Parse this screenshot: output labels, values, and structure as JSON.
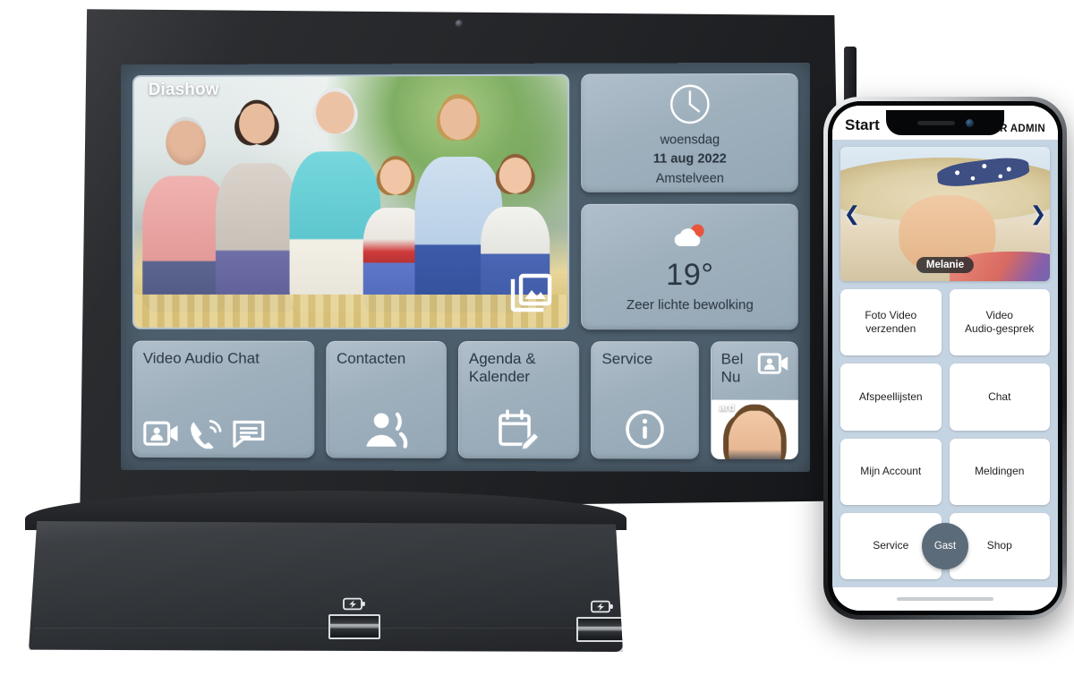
{
  "tablet": {
    "slideshow": {
      "label": "Diashow",
      "gallery_icon": "photo-library-icon"
    },
    "clock_widget": {
      "icon": "analog-clock-icon",
      "weekday": "woensdag",
      "date": "11 aug  2022",
      "location": "Amstelveen"
    },
    "weather_widget": {
      "icon": "sun-behind-cloud-icon",
      "temperature": "19°",
      "description": "Zeer lichte bewolking"
    },
    "actions": [
      {
        "id": "video-audio-chat",
        "label": "Video Audio Chat",
        "icons": [
          "video-call-icon",
          "phone-ring-icon",
          "chat-bubble-icon"
        ]
      },
      {
        "id": "contacten",
        "label": "Contacten",
        "icons": [
          "contacts-person-icon"
        ]
      },
      {
        "id": "agenda-kalender",
        "label": "Agenda &\nKalender",
        "label_line1": "Agenda &",
        "label_line2": "Kalender",
        "icons": [
          "calendar-edit-icon"
        ]
      },
      {
        "id": "service",
        "label": "Service",
        "icons": [
          "info-circle-icon"
        ]
      }
    ],
    "bel_nu": {
      "label_line1": "Bel",
      "label_line2": "Nu",
      "icon": "video-call-icon",
      "contact_name": "ard"
    },
    "colors": {
      "screen_background": "#4c5d6b",
      "tile": "#9fb0bd",
      "tile_text": "#2b3843",
      "icon": "#ffffff",
      "weather_sun": "#e8553a"
    }
  },
  "dock": {
    "ports": [
      {
        "id": "usb-left",
        "icon": "battery-charging-icon",
        "socket": "usb-a-port"
      },
      {
        "id": "usb-right",
        "icon": "battery-charging-icon",
        "socket": "usb-a-port"
      }
    ]
  },
  "phone": {
    "statusbar": {
      "title": "Start",
      "admin_link": "NAAR ADMIN"
    },
    "carousel": {
      "prev_icon": "chevron-left-icon",
      "next_icon": "chevron-right-icon",
      "caption": "Melanie"
    },
    "buttons": [
      {
        "id": "foto-video-verzenden",
        "label": "Foto Video\nverzenden",
        "line1": "Foto Video",
        "line2": "verzenden"
      },
      {
        "id": "video-audio-gesprek",
        "label": "Video\nAudio-gesprek",
        "line1": "Video",
        "line2": "Audio-gesprek"
      },
      {
        "id": "afspeellijsten",
        "label": "Afspeellijsten"
      },
      {
        "id": "chat",
        "label": "Chat"
      },
      {
        "id": "mijn-account",
        "label": "Mijn Account"
      },
      {
        "id": "meldingen",
        "label": "Meldingen"
      },
      {
        "id": "service",
        "label": "Service"
      },
      {
        "id": "shop",
        "label": "Shop"
      }
    ],
    "gast_button": {
      "id": "gast",
      "label": "Gast"
    },
    "colors": {
      "content_background": "#c5d4e2",
      "button_background": "#ffffff",
      "gast_background": "#5c6b79",
      "arrow": "#16306b"
    }
  }
}
